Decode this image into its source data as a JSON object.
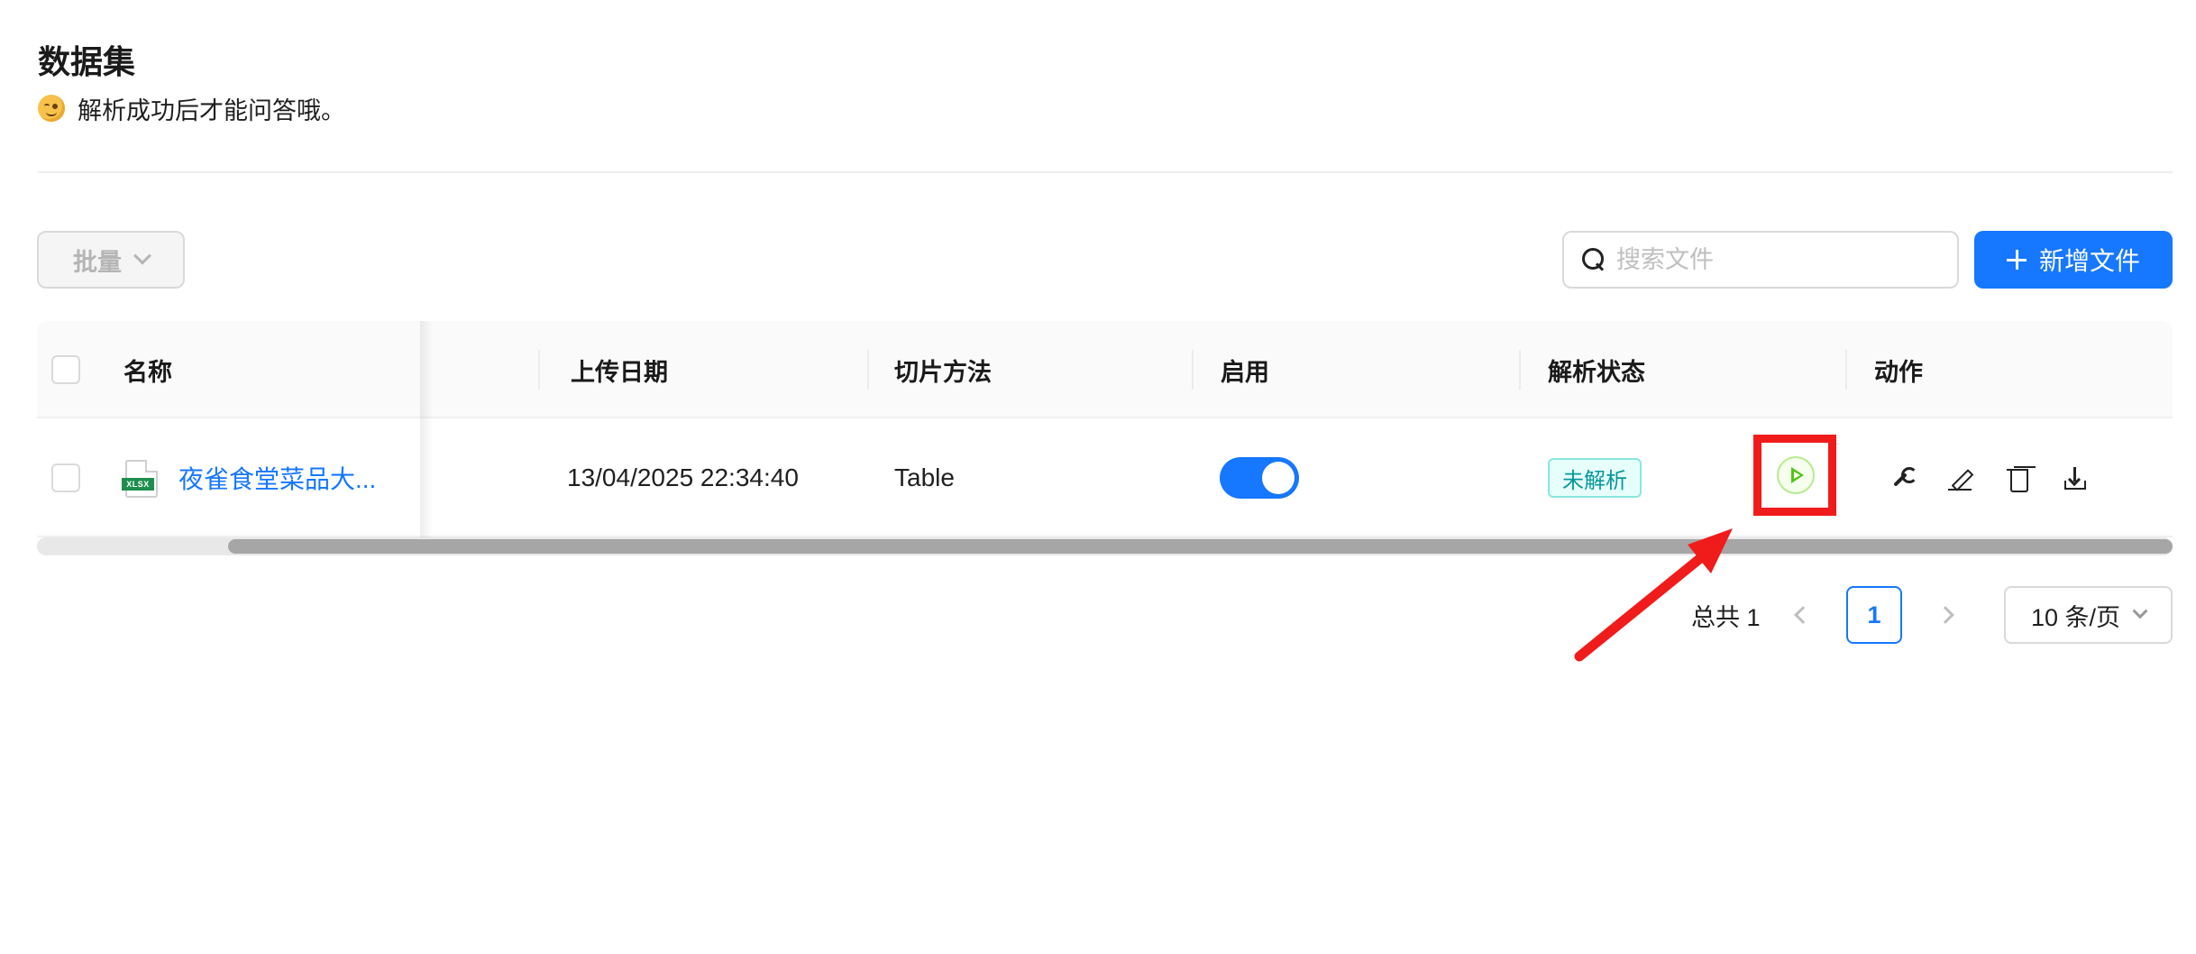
{
  "header": {
    "title": "数据集",
    "subtitle": "解析成功后才能问答哦。"
  },
  "toolbar": {
    "bulk_label": "批量",
    "search_placeholder": "搜索文件",
    "add_label": "新增文件"
  },
  "table": {
    "columns": [
      "名称",
      "上传日期",
      "切片方法",
      "启用",
      "解析状态",
      "动作"
    ],
    "rows": [
      {
        "name": "夜雀食堂菜品大...",
        "file_type": "XLSX",
        "upload_date": "13/04/2025 22:34:40",
        "chunk_method": "Table",
        "enabled": true,
        "parse_status": "未解析"
      }
    ]
  },
  "pagination": {
    "total_label": "总共 1",
    "current_page": "1",
    "page_size_label": "10 条/页"
  },
  "colors": {
    "accent": "#1677ff",
    "highlight": "#f01c1c",
    "status_tag": "#08979c",
    "play": "#52c41a"
  }
}
